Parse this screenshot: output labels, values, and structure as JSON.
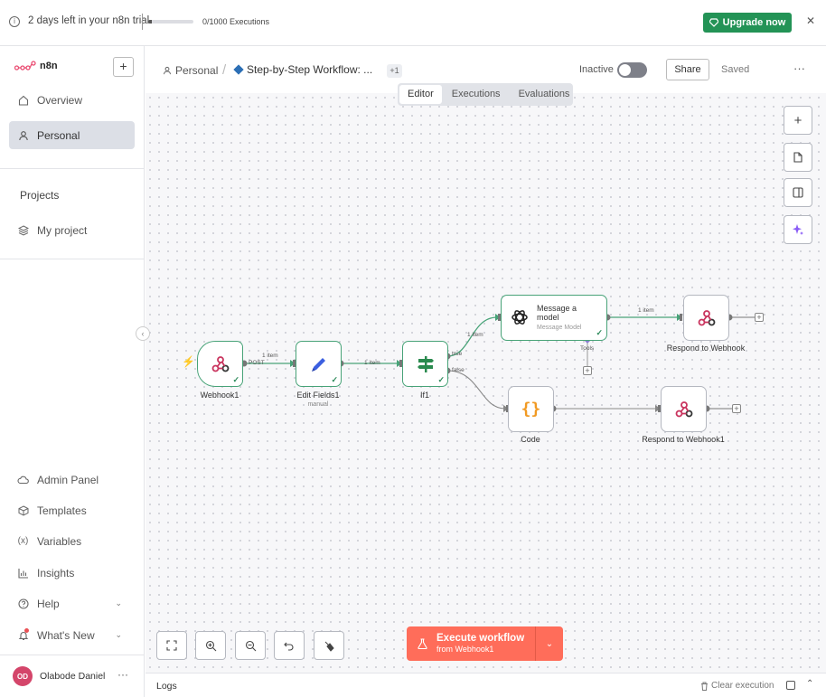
{
  "banner": {
    "trial_text": "2 days left in your n8n trial",
    "executions": "0/1000 Executions",
    "executions_progress": 0.0,
    "upgrade_label": "Upgrade now",
    "close_icon": "close-icon"
  },
  "sidebar": {
    "logo_text": "n8n",
    "add_label": "+",
    "items": [
      {
        "label": "Overview",
        "icon": "home-icon"
      },
      {
        "label": "Personal",
        "icon": "user-icon",
        "active": true
      }
    ],
    "projects_title": "Projects",
    "my_project": "My project",
    "bottom_items": [
      {
        "label": "Admin Panel",
        "icon": "cloud-icon"
      },
      {
        "label": "Templates",
        "icon": "box-icon"
      },
      {
        "label": "Variables",
        "icon": "variables-icon"
      },
      {
        "label": "Insights",
        "icon": "chart-icon"
      },
      {
        "label": "Help",
        "icon": "help-icon"
      },
      {
        "label": "What's New",
        "icon": "bell-icon"
      }
    ],
    "user": {
      "initials": "OD",
      "name": "Olabode Daniel"
    }
  },
  "header": {
    "crumb": "Personal",
    "workflow_name": "Step-by-Step Workflow: ...",
    "extra_count": "+1",
    "inactive_label": "Inactive",
    "share_label": "Share",
    "saved_label": "Saved"
  },
  "tabs": [
    "Editor",
    "Executions",
    "Evaluations"
  ],
  "nodes": {
    "webhook": {
      "label": "Webhook1"
    },
    "edit": {
      "label": "Edit Fields1",
      "sub": "manual"
    },
    "if": {
      "label": "If1"
    },
    "model": {
      "title": "Message a model",
      "sub": "Message Model",
      "tools": "Tools"
    },
    "respond": {
      "label": "Respond to Webhook"
    },
    "code": {
      "label": "Code"
    },
    "respond1": {
      "label": "Respond to Webhook1"
    }
  },
  "edges": {
    "post": "POST",
    "item1": "1 item",
    "item2": "1 item",
    "item3": "1 item",
    "item4": "1 item",
    "true": "true",
    "false": "false"
  },
  "execute": {
    "label": "Execute workflow",
    "sub": "from Webhook1"
  },
  "logs": {
    "title": "Logs",
    "clear": "Clear execution"
  }
}
